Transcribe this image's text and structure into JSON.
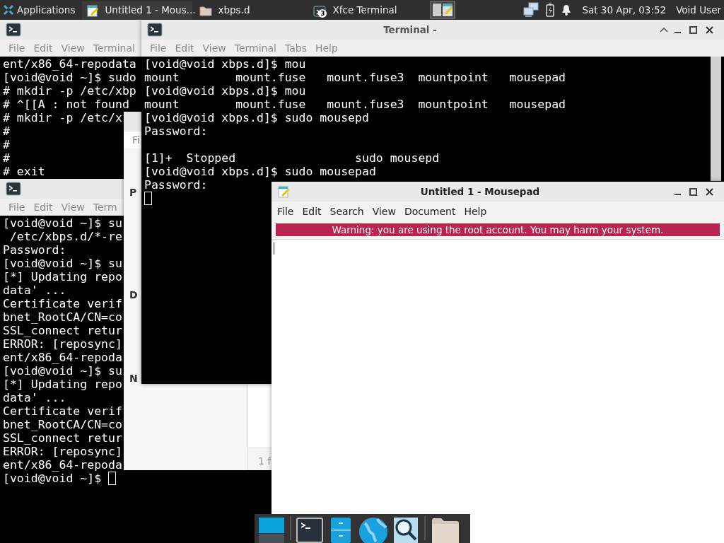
{
  "panel": {
    "menu_label": "Applications",
    "tasks": [
      {
        "kind": "editor",
        "label": "Untitled 1 - Mous...",
        "selected": true
      },
      {
        "kind": "folder",
        "label": "xbps.d",
        "selected": false
      },
      {
        "kind": "terminal",
        "label": "Xfce Terminal",
        "count": "3",
        "selected": false
      }
    ],
    "clock": "Sat 30 Apr, 03:52",
    "user": "Void User"
  },
  "windows": [
    {
      "kind": "terminal",
      "menu": [
        "File",
        "Edit",
        "View",
        "Terminal"
      ],
      "lines": [
        "ent/x86_64-repodata",
        "[void@void ~]$ sudo",
        "# mkdir -p /etc/xbp",
        "# ^[[A : not found",
        "# mkdir -p /etc/x",
        "#",
        "#",
        "#",
        "# exit"
      ]
    },
    {
      "kind": "terminal",
      "menu": [
        "File",
        "Edit",
        "View",
        "Term"
      ],
      "lines": [
        "[void@void ~]$ su",
        " /etc/xbps.d/*-re",
        "Password:",
        "[void@void ~]$ su",
        "[*] Updating repo",
        "data' ...",
        "Certificate verif",
        "bnet_RootCA/CN=co",
        "SSL_connect retur",
        "ERROR: [reposync]",
        "ent/x86_64-repoda",
        "[void@void ~]$ su",
        "[*] Updating repo",
        "data' ...",
        "Certificate verif",
        "bnet_RootCA/CN=co",
        "SSL_connect retur",
        "ERROR: [reposync]",
        "ent/x86_64-repoda",
        {
          "kind": "prompt_with_cursor",
          "text": "[void@void ~]$ "
        }
      ]
    },
    {
      "kind": "file_manager",
      "menu": [
        "Fi"
      ],
      "sidebar_headings": [
        "P",
        "D",
        "N"
      ],
      "status": "1 f"
    },
    {
      "kind": "terminal",
      "focused": false,
      "title": "Terminal -",
      "menu": [
        "File",
        "Edit",
        "View",
        "Terminal",
        "Tabs",
        "Help"
      ],
      "lines": [
        "[void@void xbps.d]$ mou",
        "mount        mount.fuse   mount.fuse3  mountpoint   mousepad",
        "[void@void xbps.d]$ mou",
        "mount        mount.fuse   mount.fuse3  mountpoint   mousepad",
        "[void@void xbps.d]$ sudo mousepd",
        "Password:",
        {
          "kind": "blank"
        },
        "[1]+  Stopped                 sudo mousepd",
        "[void@void xbps.d]$ sudo mousepad",
        "Password:",
        {
          "kind": "cursor"
        }
      ]
    },
    {
      "kind": "editor",
      "focused": true,
      "title": "Untitled 1 - Mousepad",
      "menu": [
        "File",
        "Edit",
        "Search",
        "View",
        "Document",
        "Help"
      ],
      "warning": "Warning: you are using the root account. You may harm your system."
    }
  ]
}
